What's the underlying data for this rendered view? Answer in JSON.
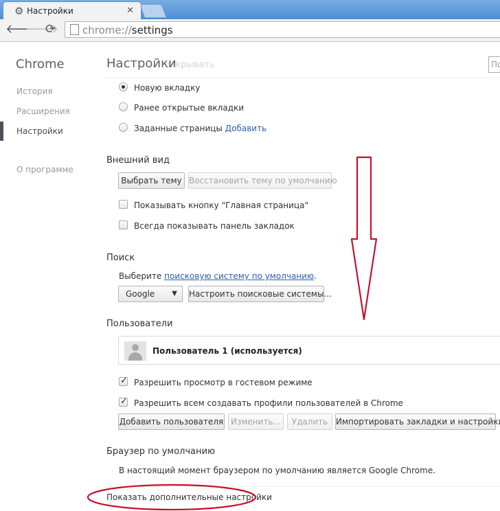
{
  "browser": {
    "tab_title": "Настройки",
    "omnibox": {
      "scheme": "chrome://",
      "path": "settings"
    }
  },
  "sidebar": {
    "brand": "Chrome",
    "items": [
      {
        "label": "История"
      },
      {
        "label": "Расширения"
      },
      {
        "label": "Настройки",
        "active": true
      },
      {
        "label": "О программе"
      }
    ]
  },
  "header": {
    "title": "Настройки",
    "ghost_text": "открывать",
    "search_placeholder": "По"
  },
  "startup": {
    "options": [
      {
        "label": "Новую вкладку",
        "checked": true
      },
      {
        "label": "Ранее открытые вкладки",
        "checked": false
      },
      {
        "label": "Заданные страницы",
        "checked": false,
        "link": "Добавить"
      }
    ]
  },
  "appearance": {
    "title": "Внешний вид",
    "choose_theme": "Выбрать тему",
    "reset_theme": "Восстановить тему по умолчанию",
    "show_home": "Показывать кнопку \"Главная страница\"",
    "show_bookmarks": "Всегда показывать панель закладок"
  },
  "search": {
    "title": "Поиск",
    "text_before": "Выберите ",
    "link": "поисковую систему по умолчанию",
    "text_after": ".",
    "engine": "Google",
    "manage": "Настроить поисковые системы..."
  },
  "users": {
    "title": "Пользователи",
    "profile_name": "Пользователь 1 (используется)",
    "guest": "Разрешить просмотр в гостевом режиме",
    "allow_create": "Разрешить всем создавать профили пользователей в Chrome",
    "buttons": {
      "add": "Добавить пользователя",
      "edit": "Изменить...",
      "delete": "Удалить",
      "import": "Импортировать закладки и настройки"
    }
  },
  "default_browser": {
    "title": "Браузер по умолчанию",
    "status": "В настоящий момент браузером по умолчанию является Google Chrome."
  },
  "footer": {
    "show_advanced": "Показать дополнительные настройки"
  },
  "colors": {
    "link": "#2a5db0",
    "annotation": "#c8102e",
    "tabstrip": "#5f9ed8"
  }
}
